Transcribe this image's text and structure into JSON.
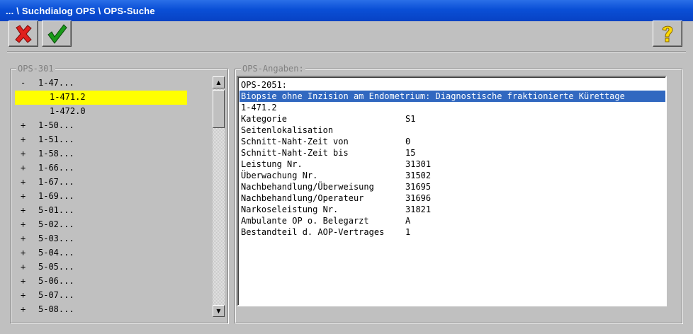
{
  "window": {
    "title": "... \\ Suchdialog OPS \\ OPS-Suche"
  },
  "toolbar": {
    "cancel_icon": "red-x-icon",
    "ok_icon": "green-check-icon",
    "help_icon": "yellow-question-icon",
    "colors": {
      "cancel": "#e0201c",
      "ok": "#1a9a1a",
      "help": "#ffd800"
    }
  },
  "left_panel": {
    "title": "OPS-301",
    "tree": [
      {
        "expander": "-",
        "label": "1-47...",
        "level": 0
      },
      {
        "expander": "",
        "label": "1-471.2",
        "level": 1,
        "selected": true
      },
      {
        "expander": "",
        "label": "1-472.0",
        "level": 1
      },
      {
        "expander": "+",
        "label": "1-50...",
        "level": 0
      },
      {
        "expander": "+",
        "label": "1-51...",
        "level": 0
      },
      {
        "expander": "+",
        "label": "1-58...",
        "level": 0
      },
      {
        "expander": "+",
        "label": "1-66...",
        "level": 0
      },
      {
        "expander": "+",
        "label": "1-67...",
        "level": 0
      },
      {
        "expander": "+",
        "label": "1-69...",
        "level": 0
      },
      {
        "expander": "+",
        "label": "5-01...",
        "level": 0
      },
      {
        "expander": "+",
        "label": "5-02...",
        "level": 0
      },
      {
        "expander": "+",
        "label": "5-03...",
        "level": 0
      },
      {
        "expander": "+",
        "label": "5-04...",
        "level": 0
      },
      {
        "expander": "+",
        "label": "5-05...",
        "level": 0
      },
      {
        "expander": "+",
        "label": "5-06...",
        "level": 0
      },
      {
        "expander": "+",
        "label": "5-07...",
        "level": 0
      },
      {
        "expander": "+",
        "label": "5-08...",
        "level": 0
      }
    ],
    "highlight_color": "#ffff00"
  },
  "right_panel": {
    "title": "OPS-Angaben:",
    "header": "OPS-2051:",
    "description": "Biopsie ohne Inzision am Endometrium: Diagnostische fraktionierte Kürettage",
    "code": "1-471.2",
    "fields": [
      {
        "label": "Kategorie",
        "value": "S1"
      },
      {
        "label": "Seitenlokalisation",
        "value": ""
      },
      {
        "label": "Schnitt-Naht-Zeit von",
        "value": "0"
      },
      {
        "label": "Schnitt-Naht-Zeit bis",
        "value": "15"
      },
      {
        "label": "Leistung Nr.",
        "value": "31301"
      },
      {
        "label": "Überwachung Nr.",
        "value": "31502"
      },
      {
        "label": "Nachbehandlung/Überweisung",
        "value": "31695"
      },
      {
        "label": "Nachbehandlung/Operateur",
        "value": "31696"
      },
      {
        "label": "Narkoseleistung Nr.",
        "value": "31821"
      },
      {
        "label": "Ambulante OP o. Belegarzt",
        "value": "A"
      },
      {
        "label": "Bestandteil d. AOP-Vertrages",
        "value": "1"
      }
    ],
    "highlight_color": "#3168c0"
  }
}
